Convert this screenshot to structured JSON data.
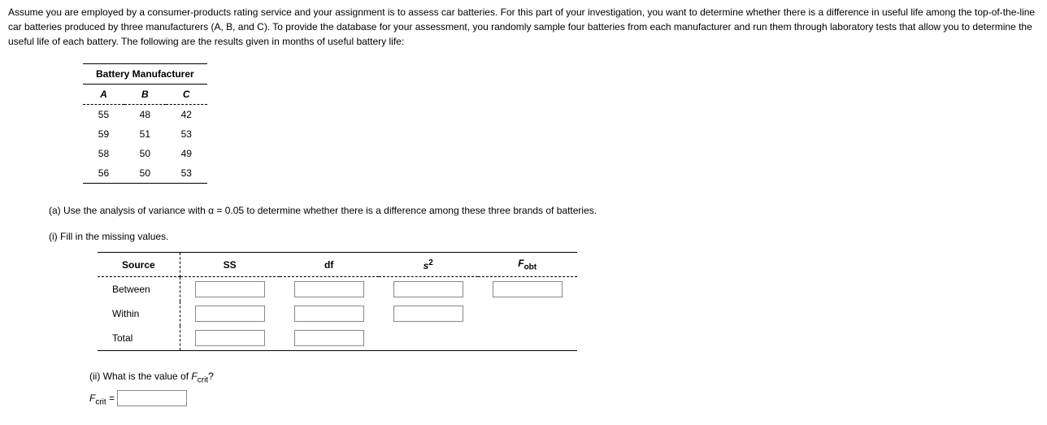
{
  "intro": "Assume you are employed by a consumer-products rating service and your assignment is to assess car batteries. For this part of your investigation, you want to determine whether there is a difference in useful life among the top-of-the-line car batteries produced by three manufacturers (A, B, and C). To provide the database for your assessment, you randomly sample four batteries from each manufacturer and run them through laboratory tests that allow you to determine the useful life of each battery. The following are the results given in months of useful battery life:",
  "data_title": "Battery Manufacturer",
  "cols": {
    "a": "A",
    "b": "B",
    "c": "C"
  },
  "rows": [
    {
      "a": "55",
      "b": "48",
      "c": "42"
    },
    {
      "a": "59",
      "b": "51",
      "c": "53"
    },
    {
      "a": "58",
      "b": "50",
      "c": "49"
    },
    {
      "a": "56",
      "b": "50",
      "c": "53"
    }
  ],
  "part_a": "(a) Use the analysis of variance with α = 0.05 to determine whether there is a difference among these three brands of batteries.",
  "part_i": "(i) Fill in the missing values.",
  "anova": {
    "h_source": "Source",
    "h_ss": "SS",
    "h_df": "df",
    "h_s2": "s",
    "h_s2_sup": "2",
    "h_f": "F",
    "h_f_sub": "obt",
    "r_between": "Between",
    "r_within": "Within",
    "r_total": "Total"
  },
  "part_ii": "(ii) What is the value of ",
  "fcrit_lbl": "F",
  "fcrit_sub": "crit",
  "qmark": "?",
  "eq": " ="
}
